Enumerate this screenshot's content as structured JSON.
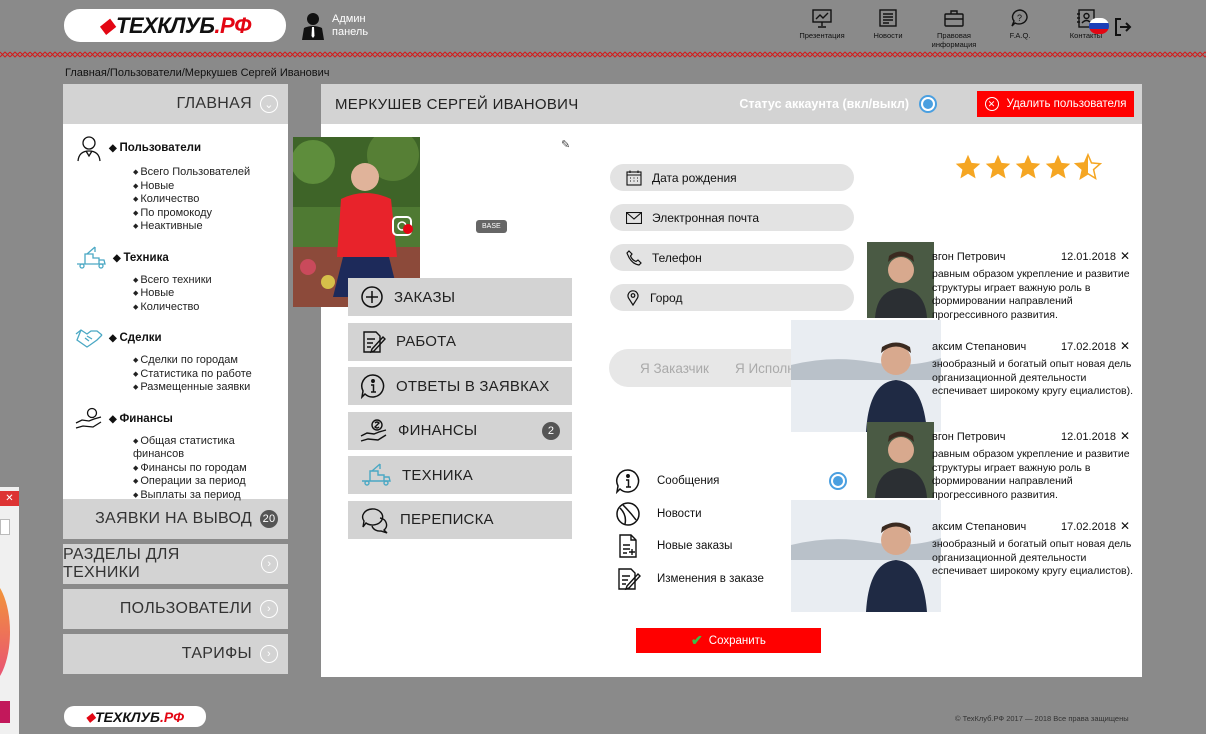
{
  "brand": {
    "logo_main": "ТЕХКЛУБ",
    "logo_suffix": ".РФ"
  },
  "admin": {
    "line1": "Админ",
    "line2": "панель"
  },
  "top_nav": [
    {
      "label": "Презентация",
      "icon": "presentation-icon"
    },
    {
      "label": "Новости",
      "icon": "news-icon"
    },
    {
      "label": "Правовая информация",
      "icon": "briefcase-icon"
    },
    {
      "label": "F.A.Q.",
      "icon": "faq-icon"
    },
    {
      "label": "Контакты",
      "icon": "contacts-icon"
    }
  ],
  "breadcrumb": "Главная/Пользователи/Меркушев Сергей Иванович",
  "sidebar": {
    "main_label": "ГЛАВНАЯ",
    "groups": [
      {
        "title": "Пользователи",
        "icon": "user-icon",
        "items": [
          "Всего Пользователей",
          "Новые",
          "Количество",
          "По промокоду",
          "Неактивные"
        ]
      },
      {
        "title": "Техника",
        "icon": "crane-truck-icon",
        "items": [
          "Всего техники",
          "Новые",
          "Количество"
        ]
      },
      {
        "title": "Сделки",
        "icon": "handshake-icon",
        "items": [
          "Сделки по городам",
          "Статистика по работе",
          "Размещенные заявки"
        ]
      },
      {
        "title": "Финансы",
        "icon": "money-hand-icon",
        "items": [
          "Общая статистика финансов",
          "Финансы по городам",
          "Операции за период",
          "Выплаты за период"
        ]
      }
    ],
    "blocks": [
      {
        "label": "ЗАЯВКИ НА ВЫВОД",
        "badge": "20"
      },
      {
        "label": "РАЗДЕЛЫ ДЛЯ ТЕХНИКИ"
      },
      {
        "label": "ПОЛЬЗОВАТЕЛИ"
      },
      {
        "label": "ТАРИФЫ"
      }
    ]
  },
  "profile": {
    "name": "МЕРКУШЕВ СЕРГЕЙ ИВАНОВИЧ",
    "status_label": "Статус аккаунта (вкл/выкл)",
    "delete_label": "Удалить пользователя",
    "base_badge": "BASE",
    "rating": 4.5,
    "actions": [
      {
        "label": "ЗАКАЗЫ",
        "icon": "plus-circle-icon"
      },
      {
        "label": "РАБОТА",
        "icon": "edit-document-icon"
      },
      {
        "label": "ОТВЕТЫ В ЗАЯВКАХ",
        "icon": "info-icon"
      },
      {
        "label": "ФИНАНСЫ",
        "icon": "money-hand-icon",
        "badge": "2"
      },
      {
        "label": "ТЕХНИКА",
        "icon": "crane-truck-icon"
      },
      {
        "label": "ПЕРЕПИСКА",
        "icon": "chat-icon"
      }
    ],
    "fields": [
      {
        "label": "Дата рождения",
        "icon": "calendar-icon"
      },
      {
        "label": "Электронная почта",
        "icon": "mail-icon"
      },
      {
        "label": "Телефон",
        "icon": "phone-icon"
      },
      {
        "label": "Город",
        "icon": "location-icon"
      }
    ],
    "toggle": {
      "option1": "Я Заказчик",
      "option2": "Я Исполнитель"
    },
    "notifications": [
      {
        "label": "Сообщения",
        "icon": "info-icon",
        "checked": true
      },
      {
        "label": "Новости",
        "icon": "news-circle-icon"
      },
      {
        "label": "Новые заказы",
        "icon": "new-doc-icon"
      },
      {
        "label": "Изменения в заказе",
        "icon": "edit-document-icon"
      }
    ],
    "save_label": "Сохранить"
  },
  "reviews": [
    {
      "name": "вгон Петрович",
      "date": "12.01.2018",
      "text": "равным образом укрепление и развитие структуры играет важную роль в формировании направлений прогрессивного развития."
    },
    {
      "name": "аксим Степанович",
      "date": "17.02.2018",
      "text": "знообразный и богатый опыт новая дель организационной деятельности еспечивает широкому кругу ециалистов)."
    },
    {
      "name": "вгон Петрович",
      "date": "12.01.2018",
      "text": "равным образом укрепление и развитие структуры играет важную роль в формировании направлений прогрессивного развития."
    },
    {
      "name": "аксим Степанович",
      "date": "17.02.2018",
      "text": "знообразный и богатый опыт новая дель организационной деятельности еспечивает широкому кругу ециалистов)."
    }
  ],
  "footer": {
    "copyright": "© ТехКлуб.РФ    2017 — 2018    Все права защищены"
  },
  "colors": {
    "accent": "#ff0000",
    "panel_gray": "#d3d3d3",
    "toggle_blue": "#4a9fe0",
    "star": "#f5a623"
  }
}
